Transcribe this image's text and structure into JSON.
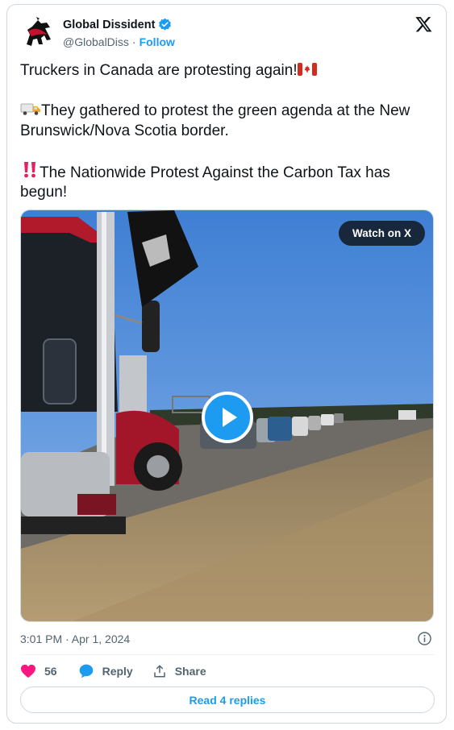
{
  "author": {
    "display_name": "Global Dissident",
    "handle": "@GlobalDiss",
    "separator": "·",
    "follow_label": "Follow",
    "verified": true,
    "avatar_icon": "horse-logo-avatar"
  },
  "tweet": {
    "line1": "Truckers in Canada are protesting again!",
    "line1_emoji": "canada-flag-icon",
    "line2": "They gathered to protest the green agenda at the New Brunswick/Nova Scotia border.",
    "line2_emoji": "delivery-truck-icon",
    "line3": "The Nationwide Protest Against the Carbon Tax has begun!",
    "line3_emoji": "double-exclamation-icon"
  },
  "media": {
    "watch_label": "Watch on X",
    "scene": "video thumbnail: convoy of trucks and cars on highway shoulder"
  },
  "meta": {
    "timestamp": "3:01 PM · Apr 1, 2024"
  },
  "actions": {
    "like_count": "56",
    "reply_label": "Reply",
    "share_label": "Share"
  },
  "read_replies_label": "Read 4 replies",
  "colors": {
    "accent": "#1d9bf0",
    "like": "#f91880",
    "text": "#0f1419",
    "muted": "#536471",
    "border": "#cfd9de"
  }
}
